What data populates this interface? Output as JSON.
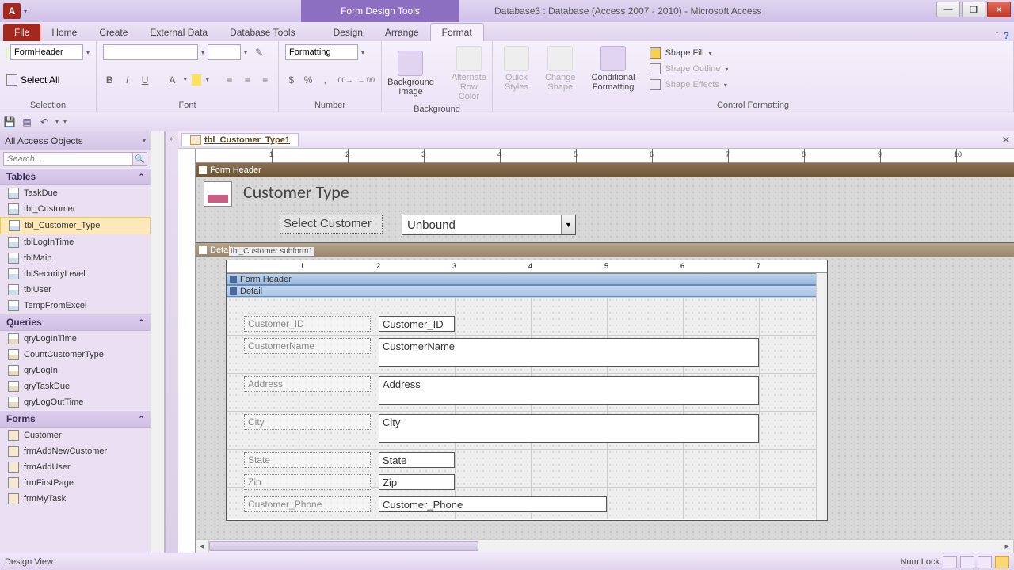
{
  "title": {
    "tool": "Form Design Tools",
    "db": "Database3 : Database (Access 2007 - 2010) - Microsoft Access",
    "accessLetter": "A"
  },
  "tabs": {
    "file": "File",
    "home": "Home",
    "create": "Create",
    "external": "External Data",
    "dbtools": "Database Tools",
    "design": "Design",
    "arrange": "Arrange",
    "format": "Format"
  },
  "ribbon": {
    "selectionBox": "FormHeader",
    "selectAll": "Select All",
    "grpSelection": "Selection",
    "formatting": "Formatting",
    "grpFont": "Font",
    "grpNumber": "Number",
    "bgImage": "Background\nImage",
    "altRow": "Alternate\nRow Color",
    "grpBackground": "Background",
    "quickStyles": "Quick\nStyles",
    "changeShape": "Change\nShape",
    "condFmt": "Conditional\nFormatting",
    "shapeFill": "Shape Fill",
    "shapeOutline": "Shape Outline",
    "shapeEffects": "Shape Effects",
    "grpCtrlFmt": "Control Formatting"
  },
  "nav": {
    "header": "All Access Objects",
    "searchPlaceholder": "Search...",
    "tables": "Tables",
    "queries": "Queries",
    "forms": "Forms",
    "tableItems": [
      "TaskDue",
      "tbl_Customer",
      "tbl_Customer_Type",
      "tblLogInTime",
      "tblMain",
      "tblSecurityLevel",
      "tblUser",
      "TempFromExcel"
    ],
    "queryItems": [
      "qryLogInTime",
      "CountCustomerType",
      "qryLogIn",
      "qryTaskDue",
      "qryLogOutTime"
    ],
    "formItems": [
      "Customer",
      "frmAddNewCustomer",
      "frmAddUser",
      "frmFirstPage",
      "frmMyTask"
    ]
  },
  "doc": {
    "tabName": "tbl_Customer_Type1",
    "formHeader": "Form Header",
    "detail": "Detail",
    "formTitle": "Customer Type",
    "selectCustomer": "Select Customer",
    "unbound": "Unbound",
    "subformName": "tbl_Customer subform1",
    "fields": {
      "custId": {
        "label": "Customer_ID",
        "value": "Customer_ID"
      },
      "custName": {
        "label": "CustomerName",
        "value": "CustomerName"
      },
      "address": {
        "label": "Address",
        "value": "Address"
      },
      "city": {
        "label": "City",
        "value": "City"
      },
      "state": {
        "label": "State",
        "value": "State"
      },
      "zip": {
        "label": "Zip",
        "value": "Zip"
      },
      "phone": {
        "label": "Customer_Phone",
        "value": "Customer_Phone"
      }
    }
  },
  "status": {
    "view": "Design View",
    "numlock": "Num Lock"
  },
  "rulerMarks": [
    "1",
    "2",
    "3",
    "4",
    "5",
    "6",
    "7",
    "8",
    "9",
    "10"
  ]
}
